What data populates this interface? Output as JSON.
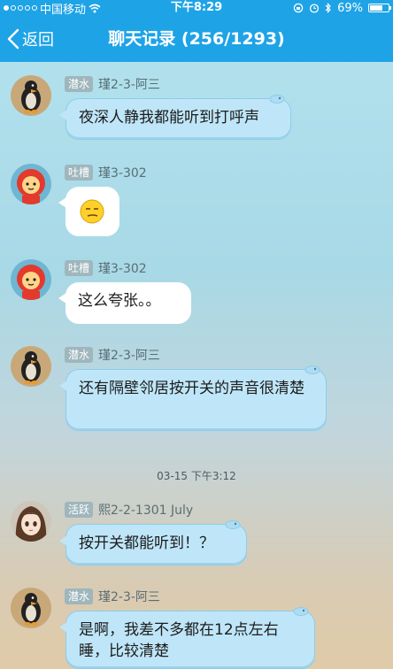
{
  "status": {
    "carrier": "中国移动",
    "time": "下午8:29",
    "battery": "69%",
    "battery_level": 0.69
  },
  "nav": {
    "back_label": "返回",
    "title": "聊天记录 (256/1293)"
  },
  "messages": [
    {
      "badge": "潜水",
      "sender": "瑾2-3-阿三",
      "text": "夜深人静我都能听到打呼声"
    },
    {
      "badge": "吐槽",
      "sender": "瑾3-302",
      "emoji": "smirk-emoji"
    },
    {
      "badge": "吐槽",
      "sender": "瑾3-302",
      "text": "这么夸张。。"
    },
    {
      "badge": "潜水",
      "sender": "瑾2-3-阿三",
      "text": "还有隔壁邻居按开关的声音很清楚"
    },
    {
      "badge": "活跃",
      "sender": "熙2-2-1301 July",
      "text": "按开关都能听到！？"
    },
    {
      "badge": "潜水",
      "sender": "瑾2-3-阿三",
      "text": "是啊，我差不多都在12点左右睡，比较清楚"
    }
  ],
  "timestamp": "03-15 下午3:12"
}
